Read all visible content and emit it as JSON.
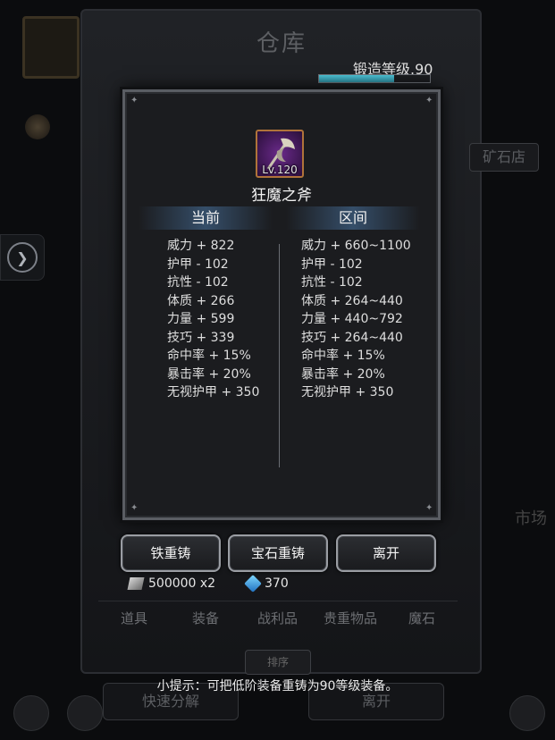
{
  "background": {
    "title": "仓库",
    "tab_labels": [
      "道具",
      "装备",
      "战利品",
      "贵重物品",
      "魔石"
    ],
    "active_tab": "装备",
    "sort_label": "排序",
    "quick_decompose": "快速分解",
    "leave_bottom": "离开",
    "ore_shop": "矿石店",
    "market": "市场"
  },
  "forge": {
    "label": "锻造等级.90",
    "progress": 0.68,
    "bar_color": "#4ec4d6"
  },
  "dialog": {
    "item": {
      "level": "Lv.120",
      "name": "狂魔之斧",
      "icon": "axe-icon",
      "frame_color": "#b0733a"
    },
    "current_header": "当前",
    "range_header": "区间",
    "current_stats": [
      "威力 + 822",
      "护甲 - 102",
      "抗性 - 102",
      "体质 + 266",
      "力量 + 599",
      "技巧 + 339",
      "命中率 + 15%",
      "暴击率 + 20%",
      "无视护甲 + 350"
    ],
    "range_stats": [
      "威力 + 660~1100",
      "护甲 - 102",
      "抗性 - 102",
      "体质 + 264~440",
      "力量 + 440~792",
      "技巧 + 264~440",
      "命中率 + 15%",
      "暴击率 + 20%",
      "无视护甲 + 350"
    ]
  },
  "actions": {
    "iron_reforge": "铁重铸",
    "gem_reforge": "宝石重铸",
    "leave": "离开"
  },
  "resources": {
    "iron": "500000 x2",
    "gem": "370"
  },
  "hint": "小提示：可把低阶装备重铸为90等级装备。"
}
